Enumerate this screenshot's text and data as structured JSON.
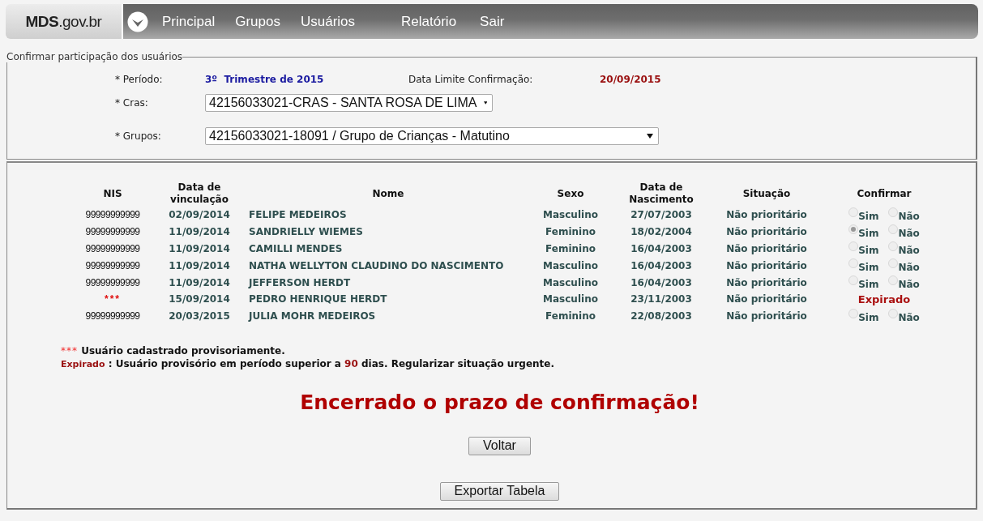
{
  "nav": {
    "logo": "**MDS**.gov.br",
    "items": [
      {
        "label": "Principal"
      },
      {
        "label": "Grupos"
      },
      {
        "label": "Usuários"
      },
      {
        "label": "Relatório"
      },
      {
        "label": "Sair"
      }
    ]
  },
  "filter": {
    "title": "Confirmar participação dos usuários",
    "period": {
      "label": "* Período:",
      "value": "3º  Trimestre de 2015"
    },
    "deadline": {
      "label": "Data Limite Confirmação:",
      "value": "20/09/2015"
    },
    "cras": {
      "label": "* Cras:",
      "value": "42156033021-CRAS - SANTA ROSA DE LIMA"
    },
    "groups": {
      "label": "* Grupos:",
      "value": "42156033021-18091 / Grupo de Crianças - Matutino"
    }
  },
  "table": {
    "columns": [
      "NIS",
      "Data de vinculação",
      "Nome",
      "Sexo",
      "Data de Nascimento",
      "Situação",
      "Confirmar"
    ],
    "rows": [
      {
        "nis": "99999999999",
        "provisional": false,
        "linked": "02/09/2014",
        "name": "FELIPE MEDEIROS",
        "sex": "Masculino",
        "birth": "27/07/2003",
        "situation": "Não prioritário",
        "confirm": {
          "kind": "radio",
          "disabled": true,
          "options": [
            {
              "label": "Sim",
              "selected": false
            },
            {
              "label": "Não",
              "selected": false
            }
          ]
        }
      },
      {
        "nis": "99999999999",
        "provisional": false,
        "linked": "11/09/2014",
        "name": "SANDRIELLY WIEMES",
        "sex": "Feminino",
        "birth": "18/02/2004",
        "situation": "Não prioritário",
        "confirm": {
          "kind": "radio",
          "disabled": true,
          "options": [
            {
              "label": "Sim",
              "selected": true
            },
            {
              "label": "Não",
              "selected": false
            }
          ]
        }
      },
      {
        "nis": "99999999999",
        "provisional": false,
        "linked": "11/09/2014",
        "name": "CAMILLI MENDES",
        "sex": "Feminino",
        "birth": "16/04/2003",
        "situation": "Não prioritário",
        "confirm": {
          "kind": "radio",
          "disabled": true,
          "options": [
            {
              "label": "Sim",
              "selected": false
            },
            {
              "label": "Não",
              "selected": false
            }
          ]
        }
      },
      {
        "nis": "99999999999",
        "provisional": false,
        "linked": "11/09/2014",
        "name": "NATHA WELLYTON CLAUDINO DO NASCIMENTO",
        "sex": "Masculino",
        "birth": "16/04/2003",
        "situation": "Não prioritário",
        "confirm": {
          "kind": "radio",
          "disabled": true,
          "options": [
            {
              "label": "Sim",
              "selected": false
            },
            {
              "label": "Não",
              "selected": false
            }
          ]
        }
      },
      {
        "nis": "99999999999",
        "provisional": false,
        "linked": "11/09/2014",
        "name": "JEFFERSON HERDT",
        "sex": "Masculino",
        "birth": "16/04/2003",
        "situation": "Não prioritário",
        "confirm": {
          "kind": "radio",
          "disabled": true,
          "options": [
            {
              "label": "Sim",
              "selected": false
            },
            {
              "label": "Não",
              "selected": false
            }
          ]
        }
      },
      {
        "nis": "***",
        "provisional": true,
        "linked": "15/09/2014",
        "name": "PEDRO HENRIQUE HERDT",
        "sex": "Masculino",
        "birth": "23/11/2003",
        "situation": "Não prioritário",
        "confirm": {
          "kind": "status",
          "text": "Expirado"
        }
      },
      {
        "nis": "99999999999",
        "provisional": false,
        "linked": "20/03/2015",
        "name": "JULIA MOHR MEDEIROS",
        "sex": "Feminino",
        "birth": "22/08/2003",
        "situation": "Não prioritário",
        "confirm": {
          "kind": "radio",
          "disabled": true,
          "options": [
            {
              "label": "Sim",
              "selected": false
            },
            {
              "label": "Não",
              "selected": false
            }
          ]
        }
      }
    ]
  },
  "legend": [
    {
      "mark": "***",
      "text": " Usuário cadastrado provisoriamente."
    },
    {
      "mark": "Expirado",
      "text": " : Usuário provisório em período superior a ",
      "number": "90",
      "text_after": " dias. Regularizar situação urgente."
    }
  ],
  "message": "Encerrado o prazo de confirmação!",
  "buttons": [
    {
      "label": "Voltar"
    },
    {
      "label": "Exportar Tabela"
    }
  ]
}
